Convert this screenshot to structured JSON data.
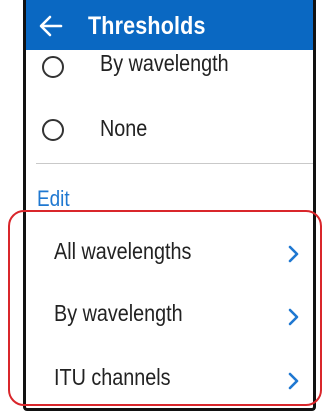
{
  "appbar": {
    "title": "Thresholds",
    "back_icon": "arrow-left-icon",
    "background": "#0a68c2"
  },
  "radio_options": [
    {
      "label": "By wavelength"
    },
    {
      "label": "None"
    }
  ],
  "edit_section": {
    "header": "Edit",
    "items": [
      {
        "label": "All wavelengths",
        "icon": "chevron-right-icon"
      },
      {
        "label": "By wavelength",
        "icon": "chevron-right-icon"
      },
      {
        "label": "ITU channels",
        "icon": "chevron-right-icon"
      }
    ]
  },
  "colors": {
    "accent": "#1f78d1",
    "highlight_frame": "#d9262b"
  }
}
